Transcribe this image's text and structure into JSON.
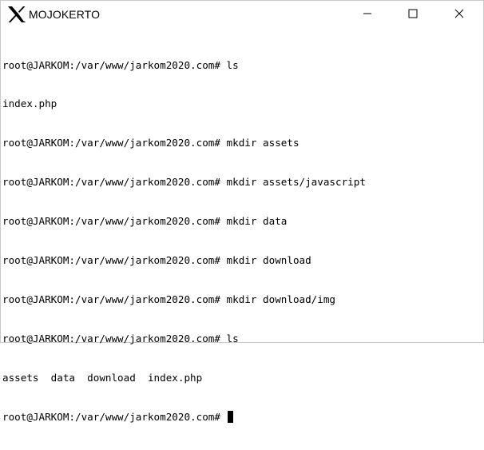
{
  "window": {
    "title": "MOJOKERTO",
    "icons": {
      "app": "x-logo-icon",
      "minimize": "minimize-icon",
      "maximize": "maximize-icon",
      "close": "close-icon"
    }
  },
  "terminal": {
    "lines": [
      "root@JARKOM:/var/www/jarkom2020.com# ls",
      "index.php",
      "root@JARKOM:/var/www/jarkom2020.com# mkdir assets",
      "root@JARKOM:/var/www/jarkom2020.com# mkdir assets/javascript",
      "root@JARKOM:/var/www/jarkom2020.com# mkdir data",
      "root@JARKOM:/var/www/jarkom2020.com# mkdir download",
      "root@JARKOM:/var/www/jarkom2020.com# mkdir download/img",
      "root@JARKOM:/var/www/jarkom2020.com# ls",
      "assets  data  download  index.php"
    ],
    "prompt": "root@JARKOM:/var/www/jarkom2020.com# "
  }
}
